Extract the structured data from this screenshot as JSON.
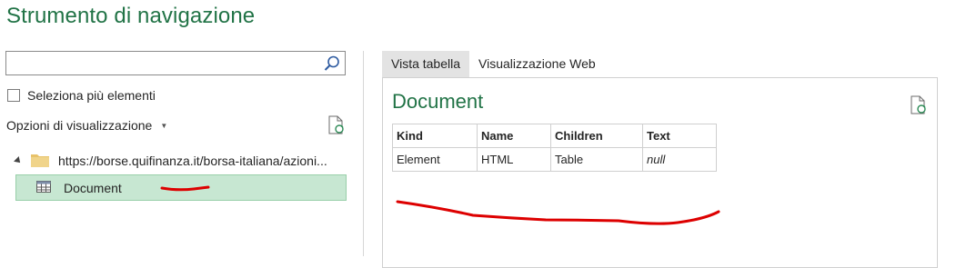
{
  "window": {
    "title": "Strumento di navigazione"
  },
  "search": {
    "value": "",
    "placeholder": ""
  },
  "multi_select": {
    "label": "Seleziona più elementi",
    "checked": false
  },
  "display_options": {
    "label": "Opzioni di visualizzazione"
  },
  "tree": {
    "source": {
      "label": "https://borse.quifinanza.it/borsa-italiana/azioni..."
    },
    "items": [
      {
        "label": "Document",
        "selected": true
      }
    ]
  },
  "tabs": [
    {
      "label": "Vista tabella",
      "active": true
    },
    {
      "label": "Visualizzazione Web",
      "active": false
    }
  ],
  "preview": {
    "title": "Document",
    "columns": [
      "Kind",
      "Name",
      "Children",
      "Text"
    ],
    "rows": [
      [
        "Element",
        "HTML",
        "Table",
        "null"
      ]
    ]
  },
  "colors": {
    "accent": "#217346",
    "selection": "#c7e7d2",
    "annotation": "#dd0000"
  }
}
